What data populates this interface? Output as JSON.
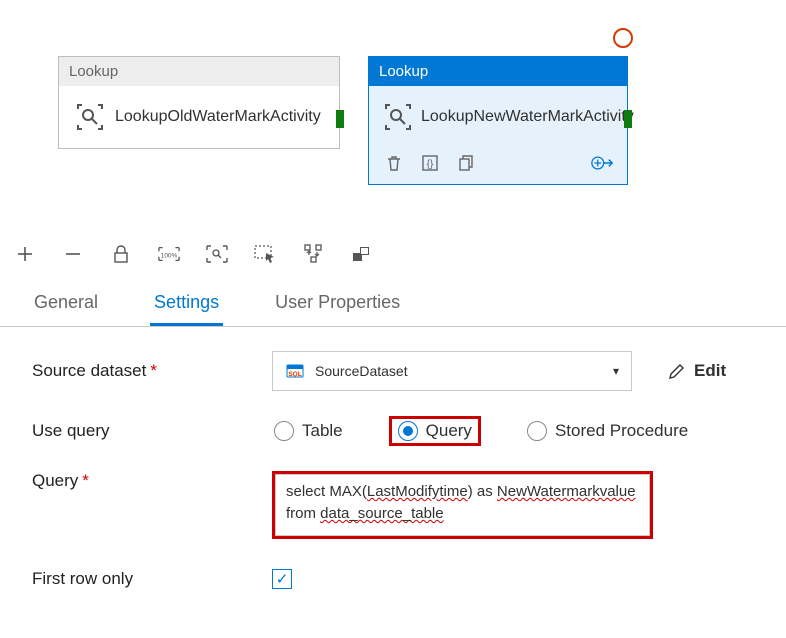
{
  "canvas": {
    "activities": [
      {
        "type": "Lookup",
        "name": "LookupOldWaterMarkActivity",
        "selected": false
      },
      {
        "type": "Lookup",
        "name": "LookupNewWaterMarkActivity",
        "selected": true
      }
    ]
  },
  "tabs": {
    "items": [
      "General",
      "Settings",
      "User Properties"
    ],
    "active": "Settings"
  },
  "settings": {
    "sourceDataset": {
      "label": "Source dataset",
      "value": "SourceDataset",
      "editLabel": "Edit"
    },
    "useQuery": {
      "label": "Use query",
      "options": [
        "Table",
        "Query",
        "Stored Procedure"
      ],
      "value": "Query"
    },
    "query": {
      "label": "Query",
      "value": "select MAX(LastModifytime) as NewWatermarkvalue from data_source_table"
    },
    "firstRowOnly": {
      "label": "First row only",
      "checked": true
    }
  }
}
